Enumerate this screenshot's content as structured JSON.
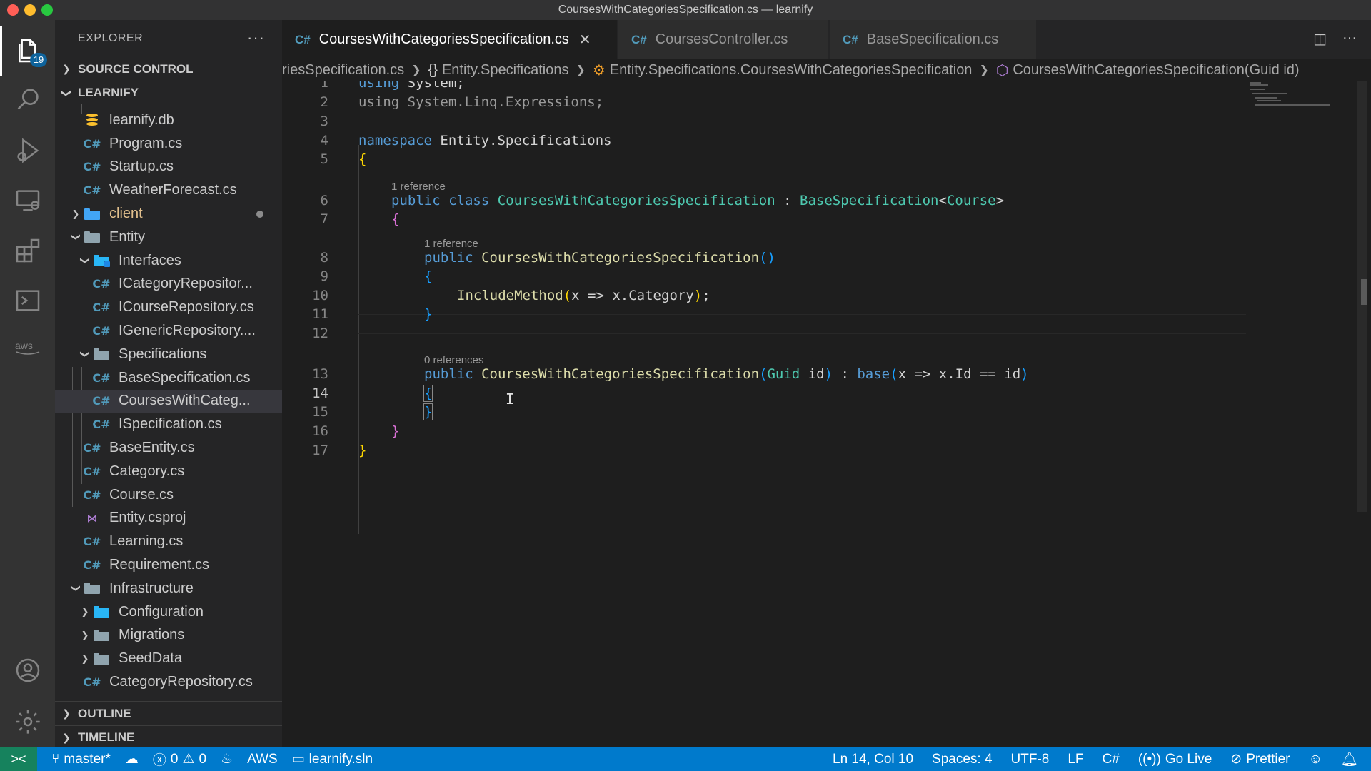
{
  "window": {
    "title": "CoursesWithCategoriesSpecification.cs — learnify"
  },
  "activity": {
    "explorer_badge": "19"
  },
  "sidebar": {
    "title": "EXPLORER",
    "more": "···",
    "source_control": "SOURCE CONTROL",
    "workspace": "LEARNIFY",
    "items": [
      {
        "label": "learnify.db",
        "icon": "database-icon"
      },
      {
        "label": "Program.cs",
        "icon": "csharp-icon"
      },
      {
        "label": "Startup.cs",
        "icon": "csharp-icon"
      },
      {
        "label": "WeatherForecast.cs",
        "icon": "csharp-icon"
      },
      {
        "label": "client",
        "icon": "folder-icon"
      },
      {
        "label": "Entity",
        "icon": "folder-open-icon"
      },
      {
        "label": "Interfaces",
        "icon": "folder-open-icon"
      },
      {
        "label": "ICategoryRepositor...",
        "icon": "csharp-icon"
      },
      {
        "label": "ICourseRepository.cs",
        "icon": "csharp-icon"
      },
      {
        "label": "IGenericRepository....",
        "icon": "csharp-icon"
      },
      {
        "label": "Specifications",
        "icon": "folder-open-icon"
      },
      {
        "label": "BaseSpecification.cs",
        "icon": "csharp-icon"
      },
      {
        "label": "CoursesWithCateg...",
        "icon": "csharp-icon"
      },
      {
        "label": "ISpecification.cs",
        "icon": "csharp-icon"
      },
      {
        "label": "BaseEntity.cs",
        "icon": "csharp-icon"
      },
      {
        "label": "Category.cs",
        "icon": "csharp-icon"
      },
      {
        "label": "Course.cs",
        "icon": "csharp-icon"
      },
      {
        "label": "Entity.csproj",
        "icon": "visual-studio-icon"
      },
      {
        "label": "Learning.cs",
        "icon": "csharp-icon"
      },
      {
        "label": "Requirement.cs",
        "icon": "csharp-icon"
      },
      {
        "label": "Infrastructure",
        "icon": "folder-open-icon"
      },
      {
        "label": "Configuration",
        "icon": "folder-icon"
      },
      {
        "label": "Migrations",
        "icon": "folder-icon"
      },
      {
        "label": "SeedData",
        "icon": "folder-icon"
      },
      {
        "label": "CategoryRepository.cs",
        "icon": "csharp-icon"
      }
    ],
    "outline": "OUTLINE",
    "timeline": "TIMELINE"
  },
  "tabs": [
    {
      "label": "CoursesWithCategoriesSpecification.cs",
      "icon": "C#",
      "close": "✕"
    },
    {
      "label": "CoursesController.cs",
      "icon": "C#"
    },
    {
      "label": "BaseSpecification.cs",
      "icon": "C#"
    }
  ],
  "breadcrumb": {
    "file": "riesSpecification.cs",
    "ns_icon": "{}",
    "namespace": "Entity.Specifications",
    "class": "Entity.Specifications.CoursesWithCategoriesSpecification",
    "member": "CoursesWithCategoriesSpecification(Guid id)"
  },
  "editor": {
    "line_numbers": [
      "1",
      "2",
      "3",
      "4",
      "5",
      "6",
      "7",
      "8",
      "9",
      "10",
      "11",
      "12",
      "13",
      "14",
      "15",
      "16",
      "17"
    ],
    "lens": [
      "1 reference",
      "1 reference",
      "0 references"
    ],
    "code": {
      "l1_kw": "using",
      "l1_rest": " System;",
      "l2": "using System.Linq.Expressions;",
      "l4_kw": "namespace",
      "l4_rest": " Entity.Specifications",
      "brace_open": "{",
      "brace_close": "}",
      "public": "public",
      "class": "class",
      "class_name": "CoursesWithCategoriesSpecification",
      "colon": " : ",
      "base_type": "BaseSpecification",
      "lt": "<",
      "gt": ">",
      "generic_arg": "Course",
      "paren_empty": "()",
      "include_method": "IncludeMethod",
      "paren_open": "(",
      "paren_close": ")",
      "lambda_body": "x => x.Category",
      "semicolon": ";",
      "guid": "Guid",
      "param": " id",
      "base": "base",
      "base_lambda": "x => x.Id == id"
    },
    "cursor": "I"
  },
  "status": {
    "remote": "><",
    "branch": "master*",
    "errors": "0",
    "warnings": "0",
    "aws": "AWS",
    "solution": "learnify.sln",
    "position": "Ln 14, Col 10",
    "spaces": "Spaces: 4",
    "encoding": "UTF-8",
    "eol": "LF",
    "language": "C#",
    "go_live": "Go Live",
    "prettier": "Prettier"
  },
  "colors": {
    "accent": "#007acc",
    "keyword": "#569cd6",
    "type": "#4ec9b0",
    "function": "#dcdcaa"
  }
}
